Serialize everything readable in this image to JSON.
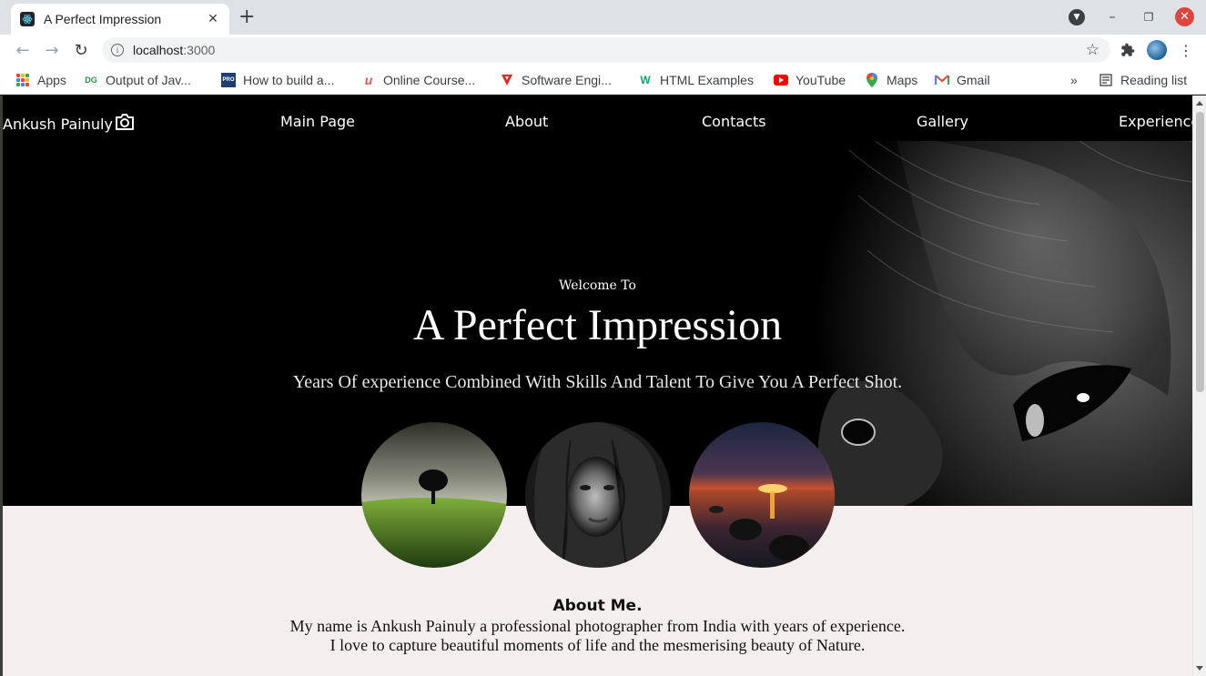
{
  "browser": {
    "tab_title": "A Perfect Impression",
    "url_host": "localhost",
    "url_port": ":3000",
    "bookmarks": [
      {
        "label": "Apps",
        "icon": "apps-grid-icon"
      },
      {
        "label": "Output of Jav...",
        "icon": "dg-icon"
      },
      {
        "label": "How to build a...",
        "icon": "pro-icon"
      },
      {
        "label": "Online Course...",
        "icon": "udemy-icon"
      },
      {
        "label": "Software Engi...",
        "icon": "triangle-icon"
      },
      {
        "label": "HTML Examples",
        "icon": "w3-icon"
      },
      {
        "label": "YouTube",
        "icon": "youtube-icon"
      },
      {
        "label": "Maps",
        "icon": "maps-pin-icon"
      },
      {
        "label": "Gmail",
        "icon": "gmail-icon"
      }
    ],
    "overflow_label": "»",
    "reading_list": "Reading list"
  },
  "site": {
    "nav": {
      "brand": "Ankush Painuly",
      "items": [
        "Main Page",
        "About",
        "Contacts",
        "Gallery",
        "Experience"
      ]
    },
    "hero": {
      "welcome": "Welcome To",
      "title": "A Perfect Impression",
      "tagline": "Years Of experience Combined With Skills And Talent To Give You A Perfect Shot."
    },
    "about": {
      "title": "About Me.",
      "line1": "My name is Ankush Painuly a professional photographer from India with years of experience.",
      "line2": "I love to capture beautiful moments of life and the mesmerising beauty of Nature."
    }
  },
  "colors": {
    "hero_bg": "#000000",
    "page_bg": "#f5eeee",
    "close_button": "#e0443e"
  }
}
